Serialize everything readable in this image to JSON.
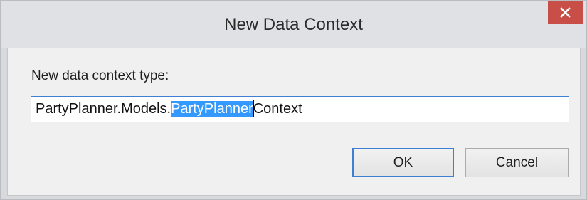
{
  "dialog": {
    "title": "New Data Context",
    "close_icon": "close-icon",
    "label": "New data context type:",
    "input": {
      "prefix": "PartyPlanner.Models.",
      "selected": "PartyPlanner",
      "suffix": "Context"
    },
    "buttons": {
      "ok": "OK",
      "cancel": "Cancel"
    }
  },
  "colors": {
    "close_button": "#c74f48",
    "selection": "#3399ff",
    "focus_border": "#3c7fd3"
  }
}
